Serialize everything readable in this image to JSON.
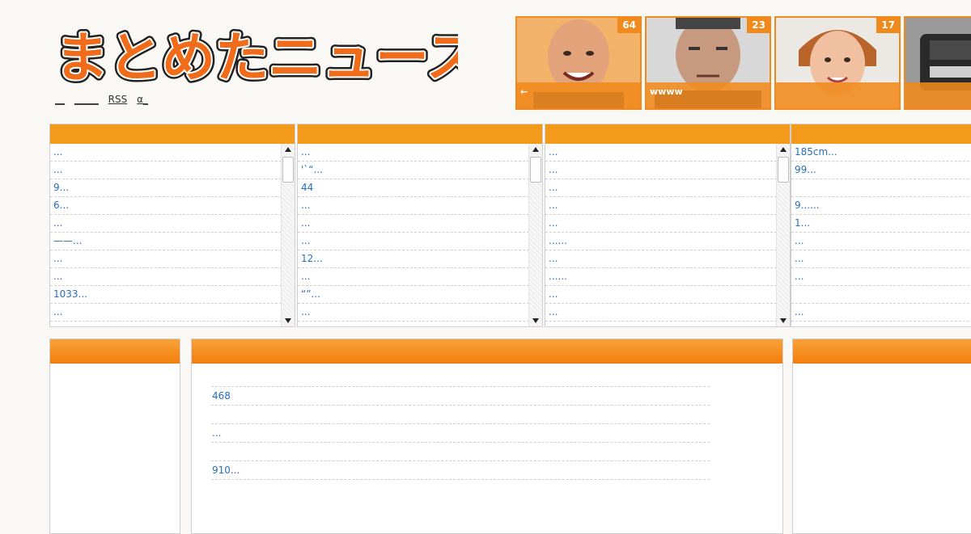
{
  "site": {
    "logo_text": "まとめたニュース"
  },
  "nav": {
    "items": [
      "__",
      "_____",
      "RSS",
      "α_"
    ]
  },
  "thumbnails": [
    {
      "count": "64",
      "caption": "←"
    },
    {
      "count": "23",
      "caption": "wwww"
    },
    {
      "count": "17",
      "caption": ""
    },
    {
      "count": "",
      "caption": ""
    }
  ],
  "columns": [
    {
      "items": [
        "...",
        "...",
        "9...",
        "6...",
        "...",
        "——...",
        "...",
        "...",
        "1033...",
        "..."
      ]
    },
    {
      "items": [
        "...",
        "'`“...",
        "44",
        "...",
        "...",
        "...",
        "12...",
        "...",
        "“”...",
        "..."
      ]
    },
    {
      "items": [
        "...",
        "...",
        "...",
        "...",
        "...",
        "......",
        "...",
        "......",
        " ...",
        "..."
      ]
    },
    {
      "items": [
        "185cm...",
        "99...",
        "",
        "9......",
        "1...",
        "...",
        "...",
        "...",
        "",
        " ..."
      ]
    }
  ],
  "main_list": {
    "items": [
      "468",
      "",
      "...",
      "",
      "910..."
    ]
  },
  "colors": {
    "accent": "#f08a1c",
    "header_bar": "#f39a1c",
    "link": "#2a6eb6"
  }
}
